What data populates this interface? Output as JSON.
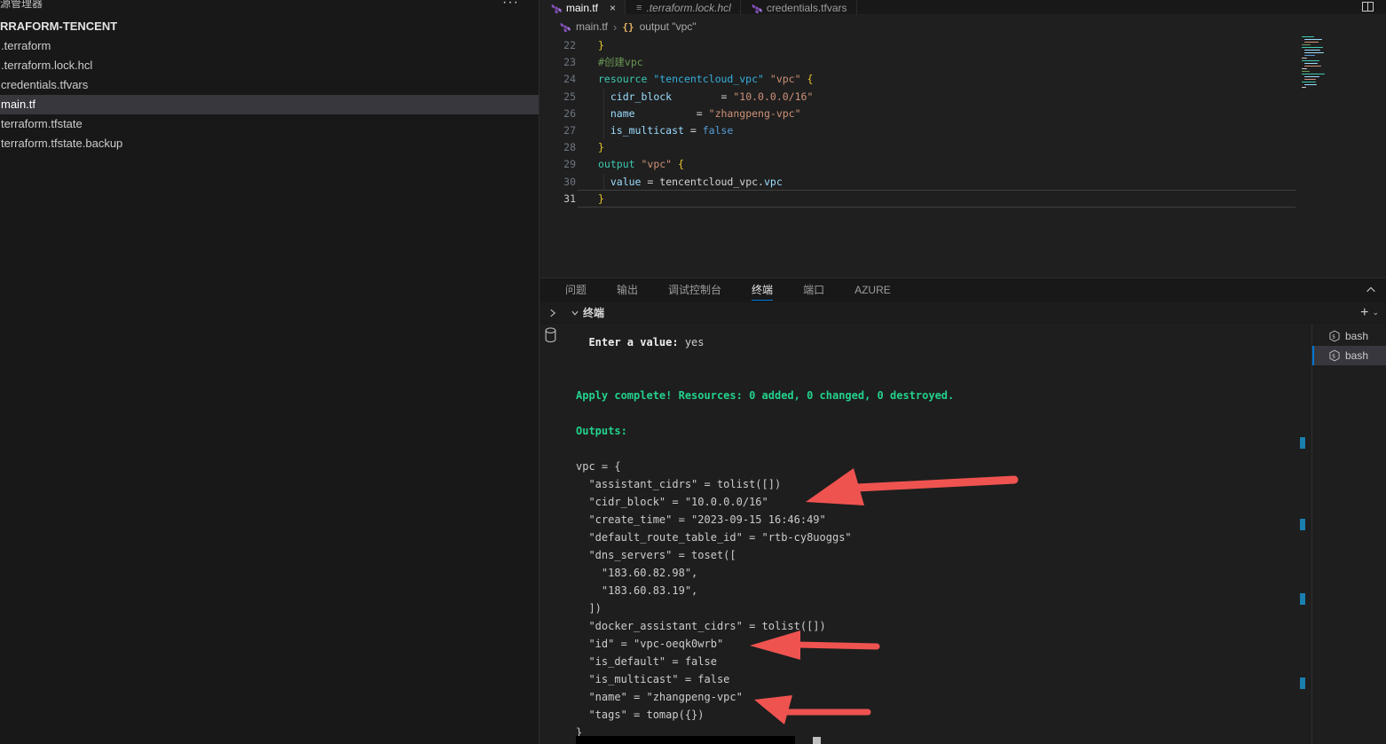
{
  "colors": {
    "terraform_purple": "#844FBA",
    "terminal_green": "#23d18b",
    "annotation_red": "#ef5350",
    "active_tab_underline": "#0078d4",
    "selection_bg": "#37373d"
  },
  "sidebar": {
    "title": "源管理器",
    "more_icon": "···",
    "section": "RRAFORM-TENCENT",
    "files": [
      {
        "label": ".terraform",
        "selected": false
      },
      {
        "label": ".terraform.lock.hcl",
        "selected": false
      },
      {
        "label": "credentials.tfvars",
        "selected": false
      },
      {
        "label": "main.tf",
        "selected": true
      },
      {
        "label": "terraform.tfstate",
        "selected": false
      },
      {
        "label": "terraform.tfstate.backup",
        "selected": false
      }
    ]
  },
  "editor_tabs": [
    {
      "label": "main.tf",
      "icon": "terraform",
      "active": true,
      "italic": false,
      "close": "×"
    },
    {
      "label": ".terraform.lock.hcl",
      "icon": "hcl",
      "active": false,
      "italic": true,
      "close": ""
    },
    {
      "label": "credentials.tfvars",
      "icon": "terraform",
      "active": false,
      "italic": false,
      "close": ""
    }
  ],
  "breadcrumb": {
    "file": "main.tf",
    "separator": "›",
    "symbol": "output \"vpc\"",
    "symbol_icon": "{}"
  },
  "editor": {
    "current_line": 31,
    "lines": [
      {
        "n": 22,
        "tokens": [
          {
            "t": "}",
            "c": "y"
          }
        ]
      },
      {
        "n": 23,
        "tokens": [
          {
            "t": "#创建vpc",
            "c": "cm"
          }
        ]
      },
      {
        "n": 24,
        "tokens": [
          {
            "t": "resource",
            "c": "k"
          },
          {
            "t": " ",
            "c": "o"
          },
          {
            "t": "\"tencentcloud_vpc\"",
            "c": "s1"
          },
          {
            "t": " ",
            "c": "o"
          },
          {
            "t": "\"vpc\"",
            "c": "s2"
          },
          {
            "t": " {",
            "c": "y"
          }
        ]
      },
      {
        "n": 25,
        "tokens": [
          {
            "t": "  ",
            "c": "o"
          },
          {
            "t": "cidr_block",
            "c": "v"
          },
          {
            "t": "        = ",
            "c": "o"
          },
          {
            "t": "\"10.0.0.0/16\"",
            "c": "s2"
          }
        ]
      },
      {
        "n": 26,
        "tokens": [
          {
            "t": "  ",
            "c": "o"
          },
          {
            "t": "name",
            "c": "v"
          },
          {
            "t": "          = ",
            "c": "o"
          },
          {
            "t": "\"zhangpeng-vpc\"",
            "c": "s2"
          }
        ]
      },
      {
        "n": 27,
        "tokens": [
          {
            "t": "  ",
            "c": "o"
          },
          {
            "t": "is_multicast",
            "c": "v"
          },
          {
            "t": " = ",
            "c": "o"
          },
          {
            "t": "false",
            "c": "b"
          }
        ]
      },
      {
        "n": 28,
        "tokens": [
          {
            "t": "}",
            "c": "y"
          }
        ]
      },
      {
        "n": 29,
        "tokens": [
          {
            "t": "output",
            "c": "k"
          },
          {
            "t": " ",
            "c": "o"
          },
          {
            "t": "\"vpc\"",
            "c": "s2"
          },
          {
            "t": " {",
            "c": "y"
          }
        ]
      },
      {
        "n": 30,
        "tokens": [
          {
            "t": "  ",
            "c": "o"
          },
          {
            "t": "value",
            "c": "v"
          },
          {
            "t": " = ",
            "c": "o"
          },
          {
            "t": "tencentcloud_vpc",
            "c": "w"
          },
          {
            "t": ".",
            "c": "o"
          },
          {
            "t": "vpc",
            "c": "v"
          }
        ]
      },
      {
        "n": 31,
        "tokens": [
          {
            "t": "}",
            "c": "y"
          }
        ]
      }
    ]
  },
  "panel": {
    "tabs": [
      {
        "label": "问题",
        "active": false
      },
      {
        "label": "输出",
        "active": false
      },
      {
        "label": "调试控制台",
        "active": false
      },
      {
        "label": "终端",
        "active": true
      },
      {
        "label": "端口",
        "active": false
      },
      {
        "label": "AZURE",
        "active": false
      }
    ],
    "header_label": "终端",
    "plus_icon": "+"
  },
  "terminal": {
    "lines": [
      {
        "parts": [
          {
            "t": "  ",
            "s": "n"
          },
          {
            "t": "Enter a value:",
            "s": "b"
          },
          {
            "t": " yes",
            "s": "n"
          }
        ]
      },
      {
        "parts": []
      },
      {
        "parts": []
      },
      {
        "parts": [
          {
            "t": "Apply complete! Resources: 0 added, 0 changed, 0 destroyed.",
            "s": "g"
          }
        ]
      },
      {
        "parts": []
      },
      {
        "parts": [
          {
            "t": "Outputs:",
            "s": "g"
          }
        ]
      },
      {
        "parts": []
      },
      {
        "parts": [
          {
            "t": "vpc = {",
            "s": "n"
          }
        ]
      },
      {
        "parts": [
          {
            "t": "  \"assistant_cidrs\" = tolist([])",
            "s": "n"
          }
        ]
      },
      {
        "parts": [
          {
            "t": "  \"cidr_block\" = \"10.0.0.0/16\"",
            "s": "n"
          }
        ]
      },
      {
        "parts": [
          {
            "t": "  \"create_time\" = \"2023-09-15 16:46:49\"",
            "s": "n"
          }
        ]
      },
      {
        "parts": [
          {
            "t": "  \"default_route_table_id\" = \"rtb-cy8uoggs\"",
            "s": "n"
          }
        ]
      },
      {
        "parts": [
          {
            "t": "  \"dns_servers\" = toset([",
            "s": "n"
          }
        ]
      },
      {
        "parts": [
          {
            "t": "    \"183.60.82.98\",",
            "s": "n"
          }
        ]
      },
      {
        "parts": [
          {
            "t": "    \"183.60.83.19\",",
            "s": "n"
          }
        ]
      },
      {
        "parts": [
          {
            "t": "  ])",
            "s": "n"
          }
        ]
      },
      {
        "parts": [
          {
            "t": "  \"docker_assistant_cidrs\" = tolist([])",
            "s": "n"
          }
        ]
      },
      {
        "parts": [
          {
            "t": "  \"id\" = \"vpc-oeqk0wrb\"",
            "s": "n"
          }
        ]
      },
      {
        "parts": [
          {
            "t": "  \"is_default\" = false",
            "s": "n"
          }
        ]
      },
      {
        "parts": [
          {
            "t": "  \"is_multicast\" = false",
            "s": "n"
          }
        ]
      },
      {
        "parts": [
          {
            "t": "  \"name\" = \"zhangpeng-vpc\"",
            "s": "n"
          }
        ]
      },
      {
        "parts": [
          {
            "t": "  \"tags\" = tomap({})",
            "s": "n"
          }
        ]
      },
      {
        "parts": [
          {
            "t": "}",
            "s": "n"
          }
        ]
      }
    ],
    "sessions": [
      {
        "label": "bash",
        "active": false
      },
      {
        "label": "bash",
        "active": true
      }
    ]
  }
}
